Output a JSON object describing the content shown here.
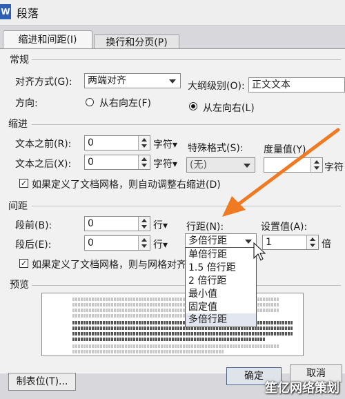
{
  "window": {
    "app_icon": "W",
    "title": "段落"
  },
  "tabs": [
    {
      "label": "缩进和间距(I)",
      "active": true
    },
    {
      "label": "换行和分页(P)",
      "active": false
    }
  ],
  "general": {
    "heading": "常规",
    "alignment_label": "对齐方式(G):",
    "alignment_value": "两端对齐",
    "outline_label": "大纲级别(O):",
    "outline_value": "正文文本",
    "direction_label": "方向:",
    "rtl_label": "从右向左(F)",
    "ltr_label": "从左向右(L)",
    "rtl_checked": false,
    "ltr_checked": true
  },
  "indent": {
    "heading": "缩进",
    "before_label": "文本之前(R):",
    "before_value": "0",
    "before_unit": "字符▾",
    "after_label": "文本之后(X):",
    "after_value": "0",
    "after_unit": "字符▾",
    "special_label": "特殊格式(S):",
    "special_value": "(无)",
    "measure_label": "度量值(Y)",
    "measure_value": "",
    "measure_unit": "字符",
    "auto_adjust_label": "如果定义了文档网格，则自动调整右缩进(D)",
    "auto_adjust_checked": true
  },
  "spacing": {
    "heading": "间距",
    "before_label": "段前(B):",
    "before_value": "0",
    "before_unit": "行▾",
    "after_label": "段后(E):",
    "after_value": "0",
    "after_unit": "行▾",
    "line_label": "行距(N):",
    "line_value": "多倍行距",
    "setting_label": "设置值(A):",
    "setting_value": "1",
    "setting_unit": "倍",
    "grid_label": "如果定义了文档网格，则与网格对齐",
    "grid_checked": true
  },
  "line_spacing_options": [
    {
      "label": "单倍行距",
      "selected": false
    },
    {
      "label": "1.5 倍行距",
      "selected": false
    },
    {
      "label": "2 倍行距",
      "selected": false
    },
    {
      "label": "最小值",
      "selected": false
    },
    {
      "label": "固定值",
      "selected": false
    },
    {
      "label": "多倍行距",
      "selected": true
    }
  ],
  "preview": {
    "heading": "预览"
  },
  "footer": {
    "tabs_button": "制表位(T)...",
    "ok_button": "确定",
    "cancel_button": "取消"
  },
  "watermark": "笙亿网络策划",
  "colors": {
    "annotation_arrow": "#f07a22",
    "dialog_bg": "#f1f1f2",
    "selection": "#e1e6f1"
  },
  "icons": {
    "annotation": "orange-arrow-icon",
    "pointer": "mouse-cursor-icon"
  }
}
